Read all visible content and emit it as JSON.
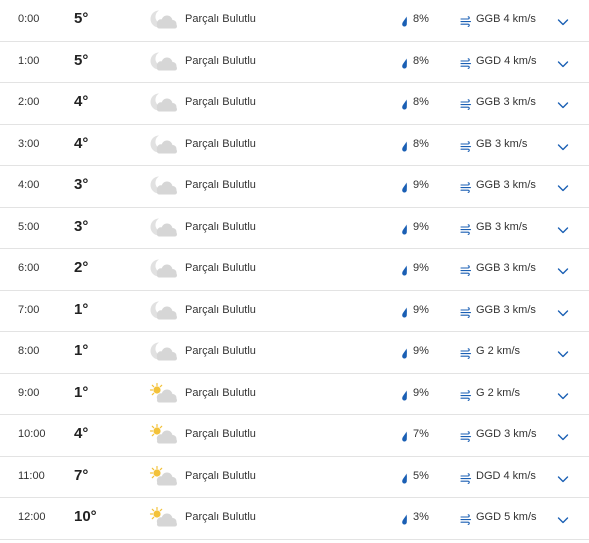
{
  "colors": {
    "accent": "#1a5fb4",
    "divider": "#e3e3e3",
    "cloud": "#d6d6d6",
    "moon": "#e1e1e1",
    "sun": "#f3c23a"
  },
  "hours": [
    {
      "time": "0:00",
      "temp": "5°",
      "icon": "moon-cloud-icon",
      "condition": "Parçalı Bulutlu",
      "rain": "8%",
      "wind": "GGB 4 km/s"
    },
    {
      "time": "1:00",
      "temp": "5°",
      "icon": "moon-cloud-icon",
      "condition": "Parçalı Bulutlu",
      "rain": "8%",
      "wind": "GGD 4 km/s"
    },
    {
      "time": "2:00",
      "temp": "4°",
      "icon": "moon-cloud-icon",
      "condition": "Parçalı Bulutlu",
      "rain": "8%",
      "wind": "GGB 3 km/s"
    },
    {
      "time": "3:00",
      "temp": "4°",
      "icon": "moon-cloud-icon",
      "condition": "Parçalı Bulutlu",
      "rain": "8%",
      "wind": "GB 3 km/s"
    },
    {
      "time": "4:00",
      "temp": "3°",
      "icon": "moon-cloud-icon",
      "condition": "Parçalı Bulutlu",
      "rain": "9%",
      "wind": "GGB 3 km/s"
    },
    {
      "time": "5:00",
      "temp": "3°",
      "icon": "moon-cloud-icon",
      "condition": "Parçalı Bulutlu",
      "rain": "9%",
      "wind": "GB 3 km/s"
    },
    {
      "time": "6:00",
      "temp": "2°",
      "icon": "moon-cloud-icon",
      "condition": "Parçalı Bulutlu",
      "rain": "9%",
      "wind": "GGB 3 km/s"
    },
    {
      "time": "7:00",
      "temp": "1°",
      "icon": "moon-cloud-icon",
      "condition": "Parçalı Bulutlu",
      "rain": "9%",
      "wind": "GGB 3 km/s"
    },
    {
      "time": "8:00",
      "temp": "1°",
      "icon": "moon-cloud-icon",
      "condition": "Parçalı Bulutlu",
      "rain": "9%",
      "wind": "G 2 km/s"
    },
    {
      "time": "9:00",
      "temp": "1°",
      "icon": "sun-cloud-icon",
      "condition": "Parçalı Bulutlu",
      "rain": "9%",
      "wind": "G 2 km/s"
    },
    {
      "time": "10:00",
      "temp": "4°",
      "icon": "sun-cloud-icon",
      "condition": "Parçalı Bulutlu",
      "rain": "7%",
      "wind": "GGD 3 km/s"
    },
    {
      "time": "11:00",
      "temp": "7°",
      "icon": "sun-cloud-icon",
      "condition": "Parçalı Bulutlu",
      "rain": "5%",
      "wind": "DGD 4 km/s"
    },
    {
      "time": "12:00",
      "temp": "10°",
      "icon": "sun-cloud-icon",
      "condition": "Parçalı Bulutlu",
      "rain": "3%",
      "wind": "GGD 5 km/s"
    }
  ]
}
